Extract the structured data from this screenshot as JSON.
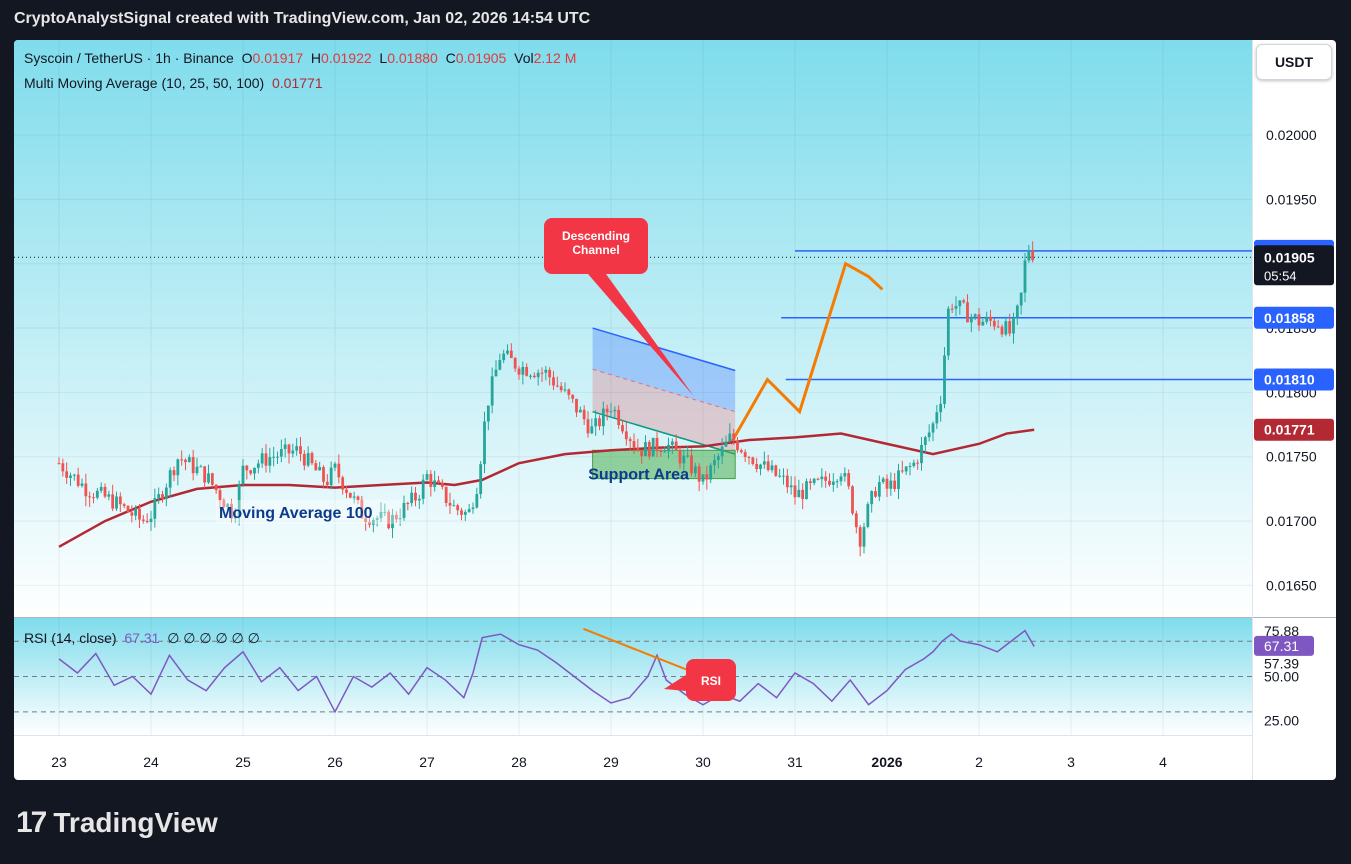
{
  "header": {
    "caption": "CryptoAnalystSignal created with TradingView.com, Jan 02, 2026 14:54 UTC"
  },
  "legend": {
    "symbol": "Syscoin / TetherUS · 1h · Binance",
    "o_label": "O",
    "o": "0.01917",
    "h_label": "H",
    "h": "0.01922",
    "l_label": "L",
    "l": "0.01880",
    "c_label": "C",
    "c": "0.01905",
    "vol_label": "Vol",
    "vol": "2.12 M",
    "ma_label": "Multi Moving Average (10, 25, 50, 100)",
    "ma_value": "0.01771",
    "rsi_label": "RSI (14, close)",
    "rsi_value": "67.31",
    "rsi_extras": "∅ ∅ ∅ ∅ ∅ ∅"
  },
  "currency_button": "USDT",
  "footer": {
    "brand": "TradingView",
    "logo_glyph": "17"
  },
  "colors": {
    "up": "#26a69a",
    "down": "#ef5350",
    "ma": "#b22833",
    "rsi": "#7e57c2",
    "level": "#2962ff",
    "arrow": "#f57c00",
    "callout": "#f23645",
    "bg_top": "#7fdcec",
    "bg_bottom": "#ffffff"
  },
  "chart_data": [
    {
      "type": "candlestick",
      "title": "Syscoin / TetherUS · 1h · Binance",
      "x_ticks": [
        "23",
        "24",
        "25",
        "26",
        "27",
        "28",
        "29",
        "30",
        "31",
        "2026",
        "2",
        "3",
        "4"
      ],
      "y_ticks": [
        "0.02000",
        "0.01950",
        "0.01900",
        "0.01850",
        "0.01800",
        "0.01750",
        "0.01700",
        "0.01650"
      ],
      "ylim": [
        0.01627,
        0.02035
      ],
      "price_path_days": [
        0.0,
        0.3,
        0.6,
        0.9,
        1.0,
        1.3,
        1.6,
        1.9,
        2.0,
        2.3,
        2.6,
        2.9,
        3.0,
        3.3,
        3.6,
        3.9,
        4.0,
        4.3,
        4.45,
        4.55,
        4.65,
        4.8,
        5.0,
        5.3,
        5.6,
        5.8,
        6.0,
        6.3,
        6.6,
        6.9,
        7.0,
        7.3,
        7.6,
        7.9,
        8.0,
        8.3,
        8.5,
        8.6,
        8.7,
        8.8,
        8.9,
        9.0,
        9.3,
        9.5,
        9.55,
        9.6,
        9.65,
        9.7,
        10.0,
        10.2,
        10.35,
        10.45,
        10.5,
        10.55,
        10.6
      ],
      "price_path_values": [
        0.01745,
        0.01725,
        0.01715,
        0.017,
        0.01705,
        0.0175,
        0.01735,
        0.01705,
        0.0174,
        0.0175,
        0.01755,
        0.0173,
        0.0174,
        0.01705,
        0.017,
        0.0172,
        0.01735,
        0.0171,
        0.01705,
        0.0173,
        0.0179,
        0.0183,
        0.0182,
        0.01815,
        0.0179,
        0.0177,
        0.0179,
        0.01755,
        0.0176,
        0.0174,
        0.0173,
        0.01765,
        0.01745,
        0.0173,
        0.0172,
        0.0173,
        0.0174,
        0.0172,
        0.01685,
        0.0171,
        0.0173,
        0.01725,
        0.01745,
        0.01775,
        0.0179,
        0.018,
        0.0186,
        0.0187,
        0.01855,
        0.01855,
        0.01845,
        0.0187,
        0.019,
        0.01915,
        0.01905
      ],
      "ma100_days": [
        0.0,
        0.5,
        1.0,
        1.5,
        2.0,
        2.5,
        3.0,
        3.5,
        4.0,
        4.3,
        4.6,
        5.0,
        5.5,
        6.0,
        6.5,
        7.0,
        7.5,
        8.0,
        8.5,
        9.0,
        9.5,
        10.0,
        10.3,
        10.6
      ],
      "ma100_values": [
        0.0168,
        0.017,
        0.01715,
        0.01725,
        0.01728,
        0.01728,
        0.01726,
        0.01728,
        0.0173,
        0.01728,
        0.01732,
        0.01745,
        0.01752,
        0.01755,
        0.01757,
        0.01758,
        0.01763,
        0.01765,
        0.01768,
        0.0176,
        0.01752,
        0.0176,
        0.01768,
        0.01771
      ],
      "levels": [
        {
          "value": 0.0191,
          "label": "0.01910",
          "from_day": 8.0
        },
        {
          "value": 0.01858,
          "label": "0.01858",
          "from_day": 7.85
        },
        {
          "value": 0.0181,
          "label": "0.01810",
          "from_day": 7.9
        }
      ],
      "current_price": {
        "value": 0.01905,
        "label": "0.01905",
        "countdown": "05:54"
      },
      "ma_price_label": {
        "value": 0.01771,
        "label": "0.01771"
      },
      "descending_channel": {
        "upper": [
          [
            5.8,
            0.0185
          ],
          [
            7.35,
            0.01817
          ]
        ],
        "lower": [
          [
            5.8,
            0.01785
          ],
          [
            7.35,
            0.01752
          ]
        ],
        "mid": [
          [
            5.8,
            0.01818
          ],
          [
            7.35,
            0.01785
          ]
        ]
      },
      "support_area": {
        "x_from": 5.8,
        "x_to": 7.35,
        "y_from": 0.01733,
        "y_to": 0.01755,
        "label": "Support Area"
      },
      "projection_path": [
        [
          7.3,
          0.0176
        ],
        [
          7.7,
          0.0181
        ],
        [
          8.05,
          0.01785
        ],
        [
          8.55,
          0.019
        ],
        [
          8.8,
          0.0189
        ],
        [
          8.95,
          0.0188
        ]
      ],
      "annotations": [
        {
          "text": "Descending Channel",
          "lines": [
            "Descending",
            "Channel"
          ],
          "kind": "callout"
        },
        {
          "text": "Moving Average 100",
          "kind": "label"
        }
      ]
    },
    {
      "type": "line",
      "title": "RSI (14, close)",
      "y_ticks": [
        "75.88",
        "67.31",
        "57.39",
        "50.00",
        "25.00"
      ],
      "ylim": [
        18,
        82
      ],
      "bands": [
        70,
        50,
        30
      ],
      "days": [
        0.0,
        0.2,
        0.4,
        0.6,
        0.8,
        1.0,
        1.2,
        1.4,
        1.6,
        1.8,
        2.0,
        2.2,
        2.4,
        2.6,
        2.8,
        3.0,
        3.2,
        3.4,
        3.6,
        3.8,
        4.0,
        4.2,
        4.4,
        4.5,
        4.6,
        4.8,
        5.0,
        5.2,
        5.4,
        5.6,
        5.8,
        6.0,
        6.2,
        6.4,
        6.5,
        6.6,
        6.8,
        7.0,
        7.2,
        7.4,
        7.6,
        7.8,
        8.0,
        8.2,
        8.4,
        8.6,
        8.8,
        9.0,
        9.2,
        9.4,
        9.5,
        9.6,
        9.7,
        9.8,
        10.0,
        10.2,
        10.4,
        10.5,
        10.6
      ],
      "values": [
        60,
        52,
        63,
        45,
        50,
        40,
        62,
        48,
        42,
        55,
        64,
        47,
        55,
        42,
        50,
        30,
        50,
        44,
        52,
        40,
        55,
        48,
        38,
        52,
        72,
        74,
        68,
        65,
        58,
        50,
        42,
        35,
        38,
        50,
        62,
        48,
        40,
        34,
        40,
        36,
        46,
        38,
        52,
        46,
        36,
        48,
        34,
        42,
        54,
        60,
        64,
        70,
        74,
        70,
        68,
        64,
        72,
        76,
        67
      ],
      "divergence_line": [
        [
          5.7,
          77
        ],
        [
          7.35,
          43
        ]
      ],
      "annotations": [
        {
          "text": "RSI",
          "kind": "callout"
        }
      ]
    }
  ]
}
